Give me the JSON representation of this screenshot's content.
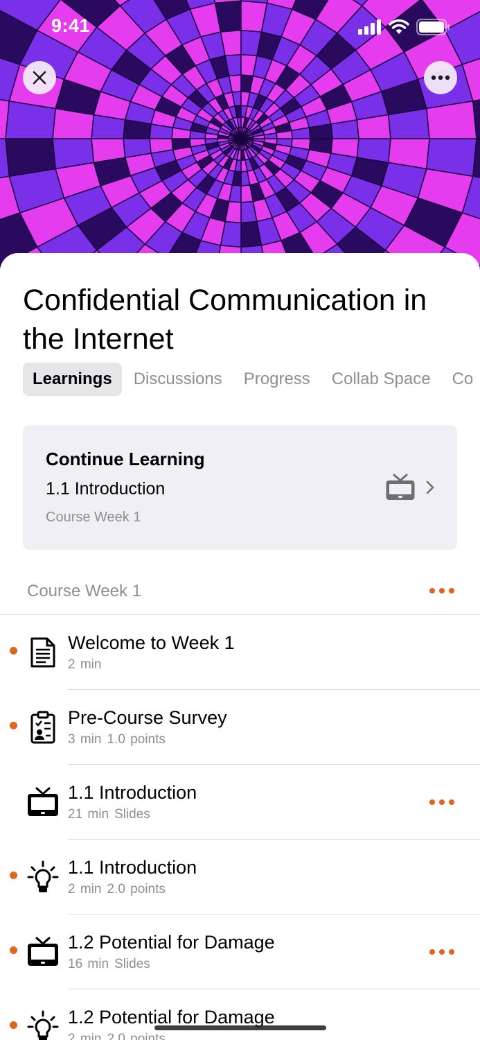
{
  "status_bar": {
    "time": "9:41"
  },
  "hero": {
    "colors": {
      "base": "#3a0e7a",
      "pink": "#e63cf0",
      "violet": "#7a2fe8",
      "dark": "#2a0a5e"
    }
  },
  "header": {
    "close_icon": "close-icon",
    "more_icon": "more-horizontal-icon"
  },
  "course": {
    "title": "Confidential Communication in the Internet"
  },
  "tabs": [
    {
      "label": "Learnings",
      "active": true
    },
    {
      "label": "Discussions",
      "active": false
    },
    {
      "label": "Progress",
      "active": false
    },
    {
      "label": "Collab Space",
      "active": false
    },
    {
      "label": "Co",
      "active": false
    }
  ],
  "continue_learning": {
    "heading": "Continue Learning",
    "item": "1.1 Introduction",
    "week": "Course Week 1",
    "icon": "video-icon"
  },
  "section": {
    "label": "Course Week 1"
  },
  "items": [
    {
      "title": "Welcome to Week 1",
      "meta": [
        "2 min"
      ],
      "icon": "document-icon",
      "unread": true,
      "more": false
    },
    {
      "title": "Pre-Course Survey",
      "meta": [
        "3 min",
        "1.0 points"
      ],
      "icon": "survey-icon",
      "unread": true,
      "more": false
    },
    {
      "title": "1.1 Introduction",
      "meta": [
        "21 min",
        "Slides"
      ],
      "icon": "video-icon",
      "unread": false,
      "more": true
    },
    {
      "title": "1.1 Introduction",
      "meta": [
        "2 min",
        "2.0 points"
      ],
      "icon": "quiz-lightbulb-icon",
      "unread": true,
      "more": false
    },
    {
      "title": "1.2 Potential for Damage",
      "meta": [
        "16 min",
        "Slides"
      ],
      "icon": "video-icon",
      "unread": true,
      "more": true
    },
    {
      "title": "1.2 Potential for Damage",
      "meta": [
        "2 min",
        "2.0 points"
      ],
      "icon": "quiz-lightbulb-icon",
      "unread": true,
      "more": false
    }
  ],
  "accent_color": "#e2651d"
}
